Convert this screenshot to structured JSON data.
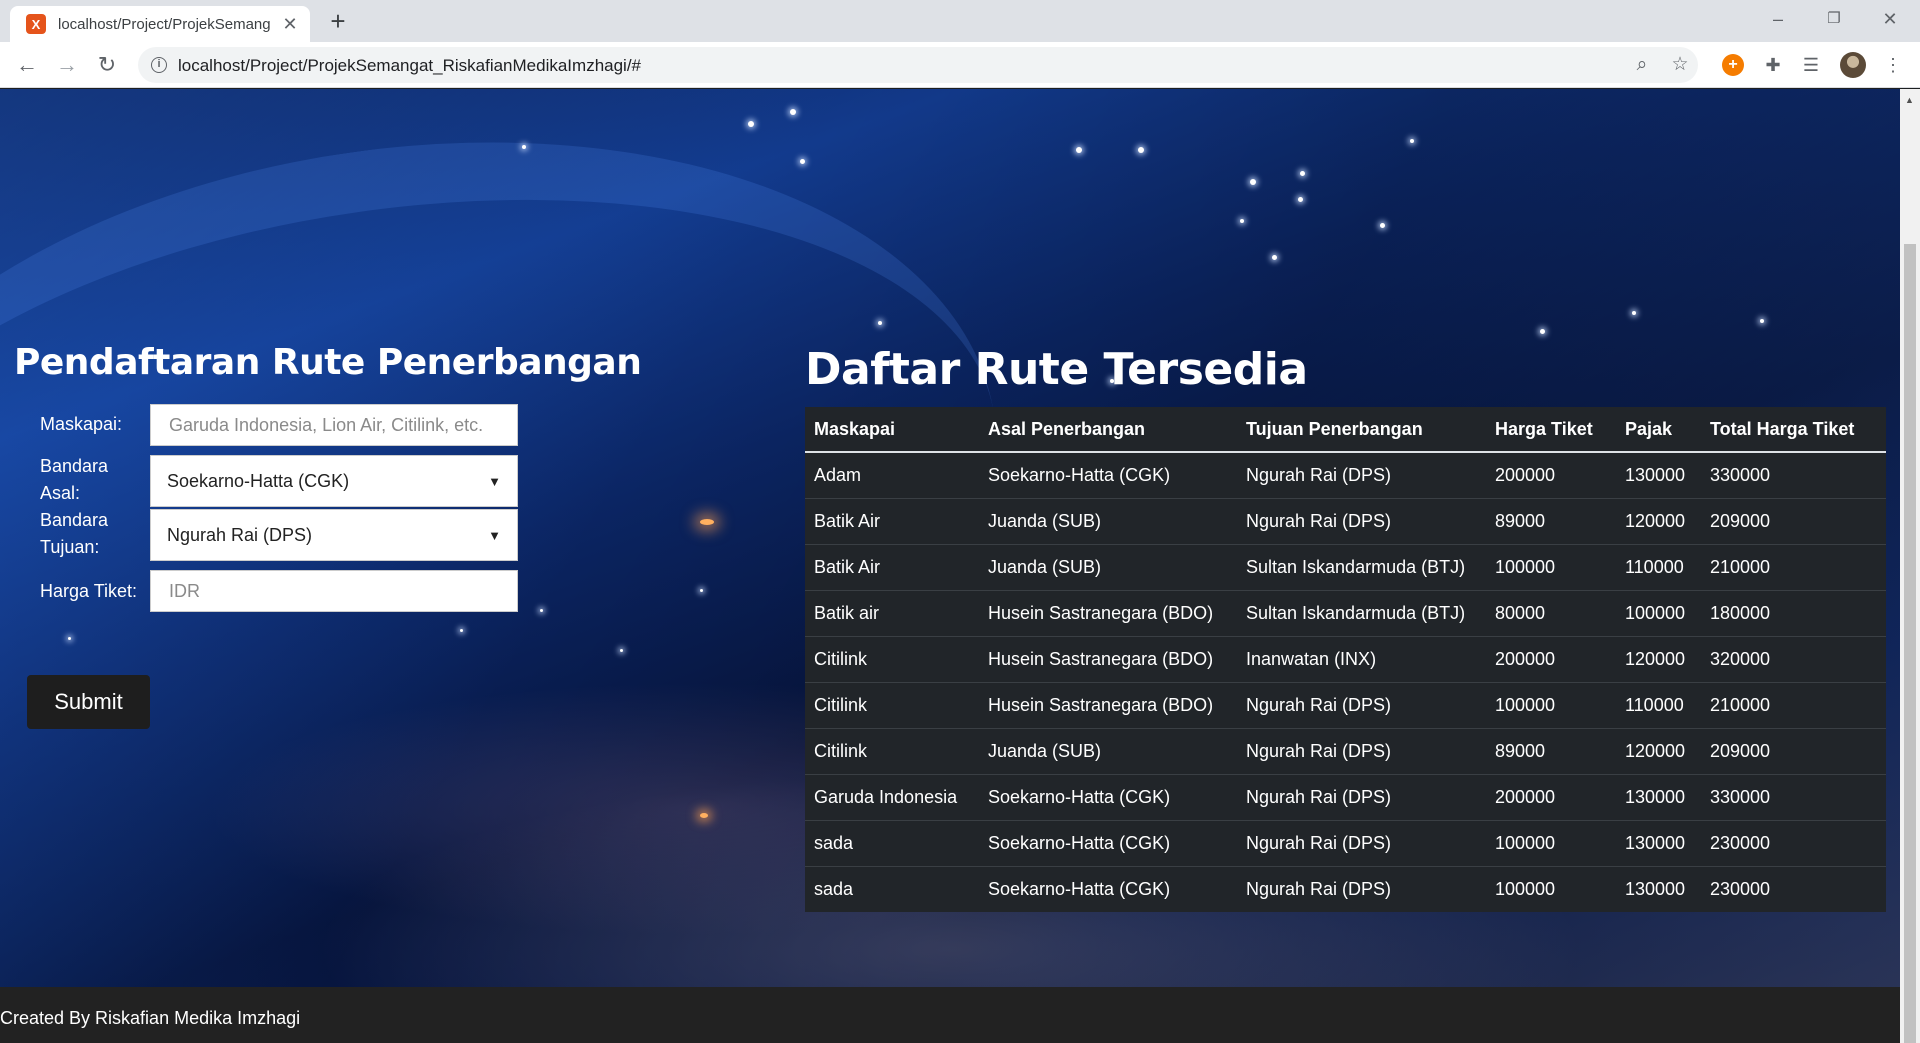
{
  "browser": {
    "tab_title": "localhost/Project/ProjekSemang",
    "favicon_letter": "X",
    "url": "localhost/Project/ProjekSemangat_RiskafianMedikaImzhagi/#",
    "icons": [
      "back-arrow-icon",
      "forward-arrow-icon",
      "reload-icon",
      "info-icon",
      "zoom-icon",
      "star-icon",
      "extensions-icon",
      "media-icon",
      "menu-icon"
    ]
  },
  "form": {
    "title": "Pendaftaran Rute Penerbangan",
    "maskapai_label": "Maskapai:",
    "maskapai_placeholder": "Garuda Indonesia, Lion Air, Citilink, etc.",
    "asal_label_1": "Bandara",
    "asal_label_2": "Asal:",
    "asal_selected": "Soekarno-Hatta (CGK)",
    "tujuan_label_1": "Bandara",
    "tujuan_label_2": "Tujuan:",
    "tujuan_selected": "Ngurah Rai (DPS)",
    "harga_label": "Harga Tiket:",
    "harga_placeholder": "IDR",
    "submit_label": "Submit"
  },
  "routes": {
    "title": "Daftar Rute Tersedia",
    "headers": [
      "Maskapai",
      "Asal Penerbangan",
      "Tujuan Penerbangan",
      "Harga Tiket",
      "Pajak",
      "Total Harga Tiket"
    ],
    "rows": [
      [
        "Adam",
        "Soekarno-Hatta (CGK)",
        "Ngurah Rai (DPS)",
        "200000",
        "130000",
        "330000"
      ],
      [
        "Batik Air",
        "Juanda (SUB)",
        "Ngurah Rai (DPS)",
        "89000",
        "120000",
        "209000"
      ],
      [
        "Batik Air",
        "Juanda (SUB)",
        "Sultan Iskandarmuda (BTJ)",
        "100000",
        "110000",
        "210000"
      ],
      [
        "Batik air",
        "Husein Sastranegara (BDO)",
        "Sultan Iskandarmuda (BTJ)",
        "80000",
        "100000",
        "180000"
      ],
      [
        "Citilink",
        "Husein Sastranegara (BDO)",
        "Inanwatan (INX)",
        "200000",
        "120000",
        "320000"
      ],
      [
        "Citilink",
        "Husein Sastranegara (BDO)",
        "Ngurah Rai (DPS)",
        "100000",
        "110000",
        "210000"
      ],
      [
        "Citilink",
        "Juanda (SUB)",
        "Ngurah Rai (DPS)",
        "89000",
        "120000",
        "209000"
      ],
      [
        "Garuda Indonesia",
        "Soekarno-Hatta (CGK)",
        "Ngurah Rai (DPS)",
        "200000",
        "130000",
        "330000"
      ],
      [
        "sada",
        "Soekarno-Hatta (CGK)",
        "Ngurah Rai (DPS)",
        "100000",
        "130000",
        "230000"
      ],
      [
        "sada",
        "Soekarno-Hatta (CGK)",
        "Ngurah Rai (DPS)",
        "100000",
        "130000",
        "230000"
      ]
    ]
  },
  "footer": {
    "text": "Created By Riskafian Medika Imzhagi"
  },
  "colors": {
    "table_bg": "#212529",
    "footer_bg": "#222222",
    "submit_bg": "#1e1e1e",
    "browser_frame": "#dee1e6"
  }
}
